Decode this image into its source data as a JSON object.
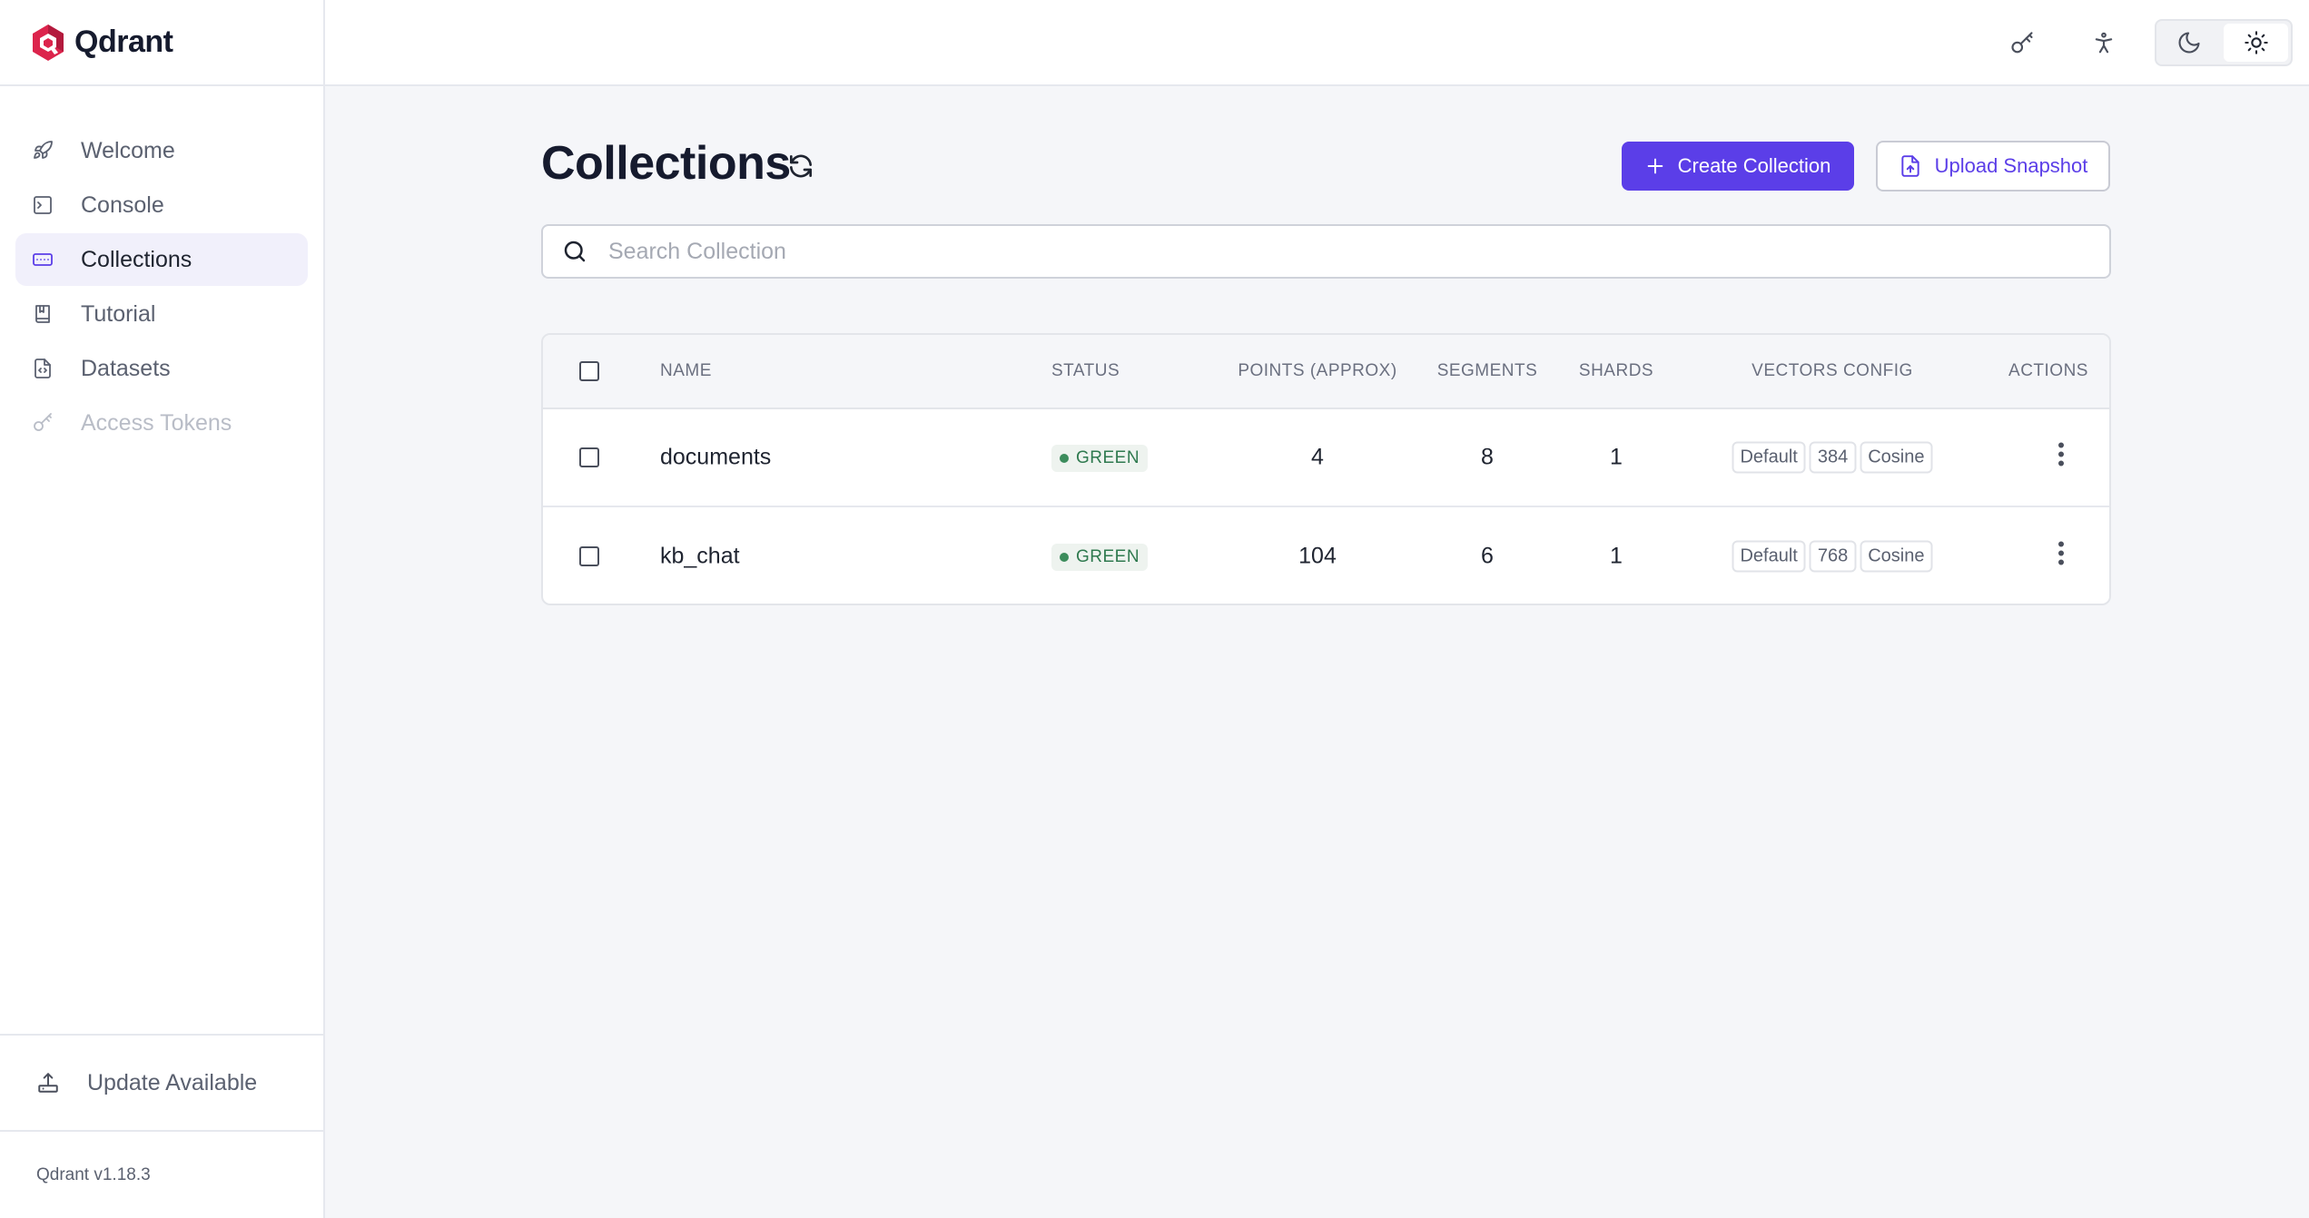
{
  "brand": {
    "name": "Qdrant"
  },
  "sidebar": {
    "items": [
      {
        "label": "Welcome",
        "icon": "rocket-icon",
        "active": false,
        "disabled": false
      },
      {
        "label": "Console",
        "icon": "terminal-icon",
        "active": false,
        "disabled": false
      },
      {
        "label": "Collections",
        "icon": "collections-icon",
        "active": true,
        "disabled": false
      },
      {
        "label": "Tutorial",
        "icon": "book-icon",
        "active": false,
        "disabled": false
      },
      {
        "label": "Datasets",
        "icon": "file-code-icon",
        "active": false,
        "disabled": false
      },
      {
        "label": "Access Tokens",
        "icon": "key-icon",
        "active": false,
        "disabled": true
      }
    ],
    "update_label": "Update Available",
    "version": "Qdrant v1.18.3"
  },
  "topbar": {
    "icons": [
      "key-icon",
      "accessibility-icon"
    ],
    "theme": {
      "options": [
        "moon-icon",
        "sun-icon"
      ],
      "selected": "light"
    }
  },
  "main": {
    "title": "Collections",
    "create_label": "Create Collection",
    "upload_label": "Upload Snapshot",
    "search_placeholder": "Search Collection",
    "search_value": ""
  },
  "table": {
    "columns": [
      "NAME",
      "STATUS",
      "POINTS (APPROX)",
      "SEGMENTS",
      "SHARDS",
      "VECTORS CONFIG",
      "ACTIONS"
    ],
    "rows": [
      {
        "name": "documents",
        "status": "GREEN",
        "points": "4",
        "segments": "8",
        "shards": "1",
        "vectors": [
          "Default",
          "384",
          "Cosine"
        ]
      },
      {
        "name": "kb_chat",
        "status": "GREEN",
        "points": "104",
        "segments": "6",
        "shards": "1",
        "vectors": [
          "Default",
          "768",
          "Cosine"
        ]
      }
    ]
  },
  "colors": {
    "accent": "#5b3ee8",
    "status_green": "#3c8c5c",
    "brand_red": "#dc244c"
  }
}
